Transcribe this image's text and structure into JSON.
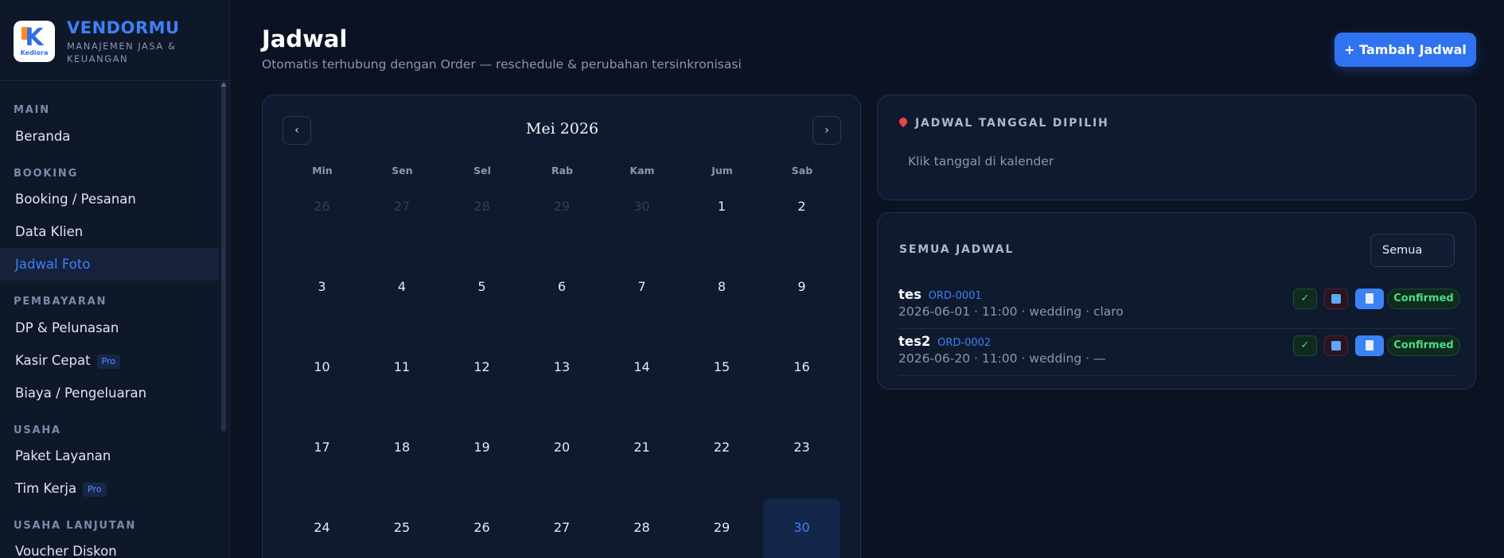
{
  "brand": {
    "name": "VENDORMU",
    "subtitle": "MANAJEMEN JASA & KEUANGAN",
    "logo_text": "Kediora"
  },
  "sidebar": {
    "sections": [
      {
        "title": "MAIN",
        "items": [
          {
            "label": "Beranda"
          }
        ]
      },
      {
        "title": "BOOKING",
        "items": [
          {
            "label": "Booking / Pesanan"
          },
          {
            "label": "Data Klien"
          },
          {
            "label": "Jadwal Foto",
            "active": true
          }
        ]
      },
      {
        "title": "PEMBAYARAN",
        "items": [
          {
            "label": "DP & Pelunasan"
          },
          {
            "label": "Kasir Cepat",
            "badge": "Pro"
          },
          {
            "label": "Biaya / Pengeluaran"
          }
        ]
      },
      {
        "title": "USAHA",
        "items": [
          {
            "label": "Paket Layanan"
          },
          {
            "label": "Tim Kerja",
            "badge": "Pro"
          }
        ]
      },
      {
        "title": "USAHA LANJUTAN",
        "items": [
          {
            "label": "Voucher Diskon"
          }
        ]
      }
    ]
  },
  "header": {
    "title": "Jadwal",
    "subtitle": "Otomatis terhubung dengan Order — reschedule & perubahan tersinkronisasi",
    "add_button": "+ Tambah Jadwal"
  },
  "calendar": {
    "month_label": "Mei 2026",
    "prev": "‹",
    "next": "›",
    "weekdays": [
      "Min",
      "Sen",
      "Sel",
      "Rab",
      "Kam",
      "Jum",
      "Sab"
    ],
    "days": [
      {
        "d": "26",
        "muted": true
      },
      {
        "d": "27",
        "muted": true
      },
      {
        "d": "28",
        "muted": true
      },
      {
        "d": "29",
        "muted": true
      },
      {
        "d": "30",
        "muted": true
      },
      {
        "d": "1"
      },
      {
        "d": "2"
      },
      {
        "d": "3"
      },
      {
        "d": "4"
      },
      {
        "d": "5"
      },
      {
        "d": "6"
      },
      {
        "d": "7"
      },
      {
        "d": "8"
      },
      {
        "d": "9"
      },
      {
        "d": "10"
      },
      {
        "d": "11"
      },
      {
        "d": "12"
      },
      {
        "d": "13"
      },
      {
        "d": "14"
      },
      {
        "d": "15"
      },
      {
        "d": "16"
      },
      {
        "d": "17"
      },
      {
        "d": "18"
      },
      {
        "d": "19"
      },
      {
        "d": "20"
      },
      {
        "d": "21"
      },
      {
        "d": "22"
      },
      {
        "d": "23"
      },
      {
        "d": "24"
      },
      {
        "d": "25"
      },
      {
        "d": "26"
      },
      {
        "d": "27"
      },
      {
        "d": "28"
      },
      {
        "d": "29"
      },
      {
        "d": "30",
        "selected": true
      }
    ]
  },
  "selected_panel": {
    "title": "JADWAL TANGGAL DIPILIH",
    "empty_text": "Klik tanggal di kalender"
  },
  "all_schedules": {
    "title": "SEMUA JADWAL",
    "filter_value": "Semua",
    "rows": [
      {
        "name": "tes",
        "order": "ORD-0001",
        "meta": "2026-06-01 · 11:00 · wedding · claro",
        "status": "Confirmed"
      },
      {
        "name": "tes2",
        "order": "ORD-0002",
        "meta": "2026-06-20 · 11:00 · wedding · —",
        "status": "Confirmed"
      }
    ]
  },
  "colors": {
    "accent": "#3b82f6",
    "success": "#4ade80",
    "background": "#0b1222"
  }
}
